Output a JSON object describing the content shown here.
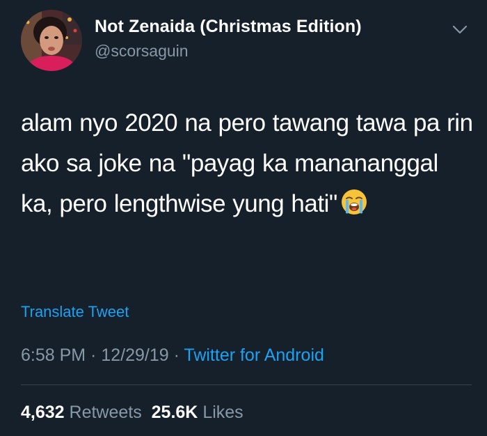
{
  "author": {
    "display_name": "Not Zenaida (Christmas Edition)",
    "handle": "@scorsaguin",
    "avatar_icon": "profile-photo"
  },
  "menu_icon": "chevron-down-icon",
  "tweet": {
    "text": "alam nyo 2020 na pero tawang tawa pa rin ako sa joke na \"payag ka manananggal ka, pero lengthwise yung hati\"",
    "emoji": "loudly-crying-face-emoji"
  },
  "translate_label": "Translate Tweet",
  "meta": {
    "time": "6:58 PM",
    "separator1": " · ",
    "date": "12/29/19",
    "separator2": " · ",
    "source": "Twitter for Android"
  },
  "stats": {
    "retweets_count": "4,632",
    "retweets_label": "Retweets",
    "likes_count": "25.6K",
    "likes_label": "Likes"
  },
  "colors": {
    "background": "#15202b",
    "text_primary": "#ffffff",
    "text_secondary": "#8899a6",
    "link": "#1da1f2",
    "divider": "#38444d"
  }
}
